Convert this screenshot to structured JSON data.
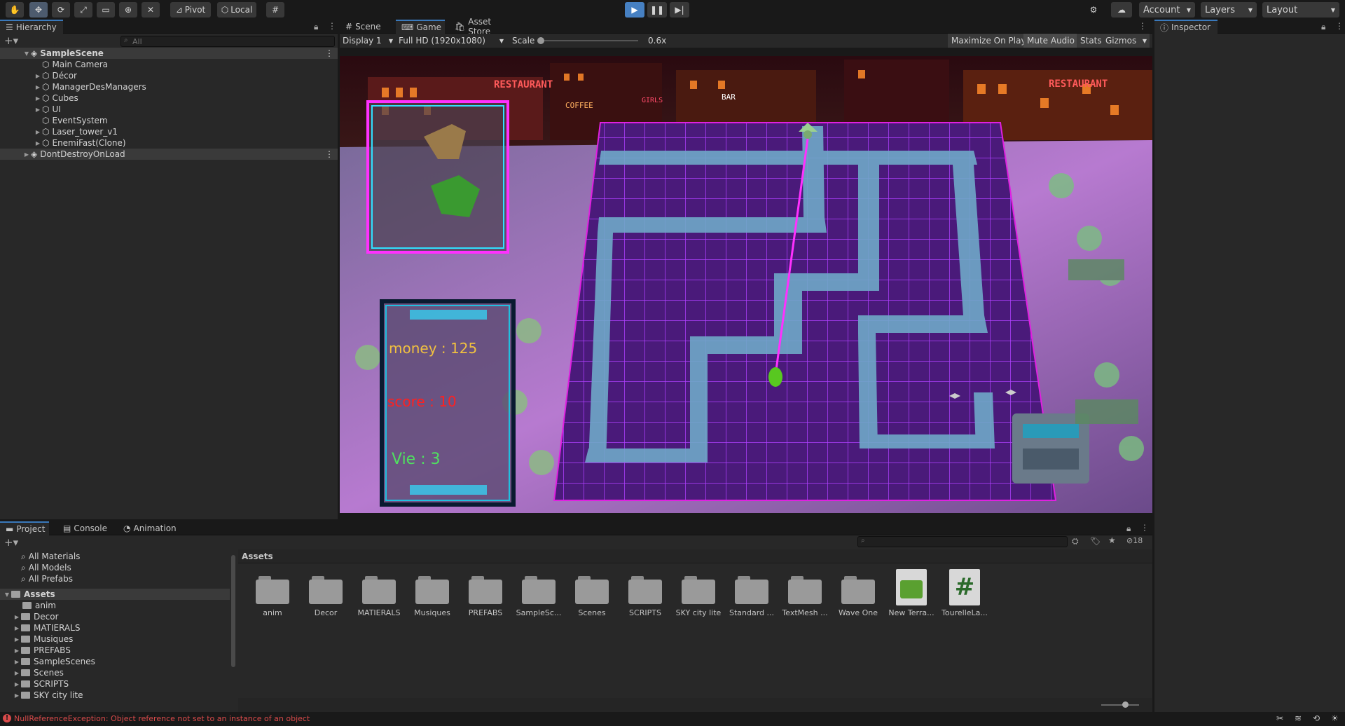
{
  "toolbar": {
    "pivot_label": "Pivot",
    "local_label": "Local",
    "account_label": "Account",
    "layers_label": "Layers",
    "layout_label": "Layout"
  },
  "hierarchy": {
    "tab_label": "Hierarchy",
    "search_placeholder": "All",
    "scene_name": "SampleScene",
    "items": [
      {
        "label": "Main Camera"
      },
      {
        "label": "Décor"
      },
      {
        "label": "ManagerDesManagers"
      },
      {
        "label": "Cubes"
      },
      {
        "label": "UI"
      },
      {
        "label": "EventSystem"
      },
      {
        "label": "Laser_tower_v1"
      },
      {
        "label": "EnemiFast(Clone)"
      }
    ],
    "ddol_label": "DontDestroyOnLoad"
  },
  "center_tabs": {
    "scene": "Scene",
    "game": "Game",
    "asset_store": "Asset Store"
  },
  "game_toolbar": {
    "display": "Display 1",
    "resolution": "Full HD (1920x1080)",
    "scale_label": "Scale",
    "scale_value": "0.6x",
    "scale_fraction": 0.0,
    "maximize": "Maximize On Play",
    "mute": "Mute Audio",
    "stats": "Stats",
    "gizmos": "Gizmos"
  },
  "game_hud": {
    "money": "money : 125",
    "score": "score : 10",
    "vie": "Vie : 3",
    "sign_restaurant": "RESTAURANT",
    "sign_coffee": "COFFEE",
    "sign_bar": "BAR",
    "sign_girls": "GIRLS"
  },
  "inspector": {
    "tab_label": "Inspector"
  },
  "bottom_tabs": {
    "project": "Project",
    "console": "Console",
    "animation": "Animation"
  },
  "project": {
    "favorites": [
      "All Materials",
      "All Models",
      "All Prefabs"
    ],
    "assets_root": "Assets",
    "tree": [
      "anim",
      "Decor",
      "MATIERALS",
      "Musiques",
      "PREFABS",
      "SampleScenes",
      "Scenes",
      "SCRIPTS",
      "SKY city lite"
    ],
    "breadcrumb": "Assets",
    "hidden_count": "18",
    "grid_items": [
      {
        "label": "anim",
        "kind": "folder"
      },
      {
        "label": "Decor",
        "kind": "folder"
      },
      {
        "label": "MATIERALS",
        "kind": "folder"
      },
      {
        "label": "Musiques",
        "kind": "folder"
      },
      {
        "label": "PREFABS",
        "kind": "folder"
      },
      {
        "label": "SampleSc...",
        "kind": "folder"
      },
      {
        "label": "Scenes",
        "kind": "folder"
      },
      {
        "label": "SCRIPTS",
        "kind": "folder"
      },
      {
        "label": "SKY city lite",
        "kind": "folder"
      },
      {
        "label": "Standard ...",
        "kind": "folder"
      },
      {
        "label": "TextMesh ...",
        "kind": "folder"
      },
      {
        "label": "Wave One",
        "kind": "folder"
      },
      {
        "label": "New Terra...",
        "kind": "terrain"
      },
      {
        "label": "TourelleLa...",
        "kind": "script"
      }
    ]
  },
  "status": {
    "error": "NullReferenceException: Object reference not set to an instance of an object"
  },
  "colors": {
    "accent": "#3a79bb",
    "error": "#d94a4a",
    "maze_wall": "#4a1a7a",
    "maze_path": "#6fa8c8",
    "neon": "#e020e0"
  }
}
